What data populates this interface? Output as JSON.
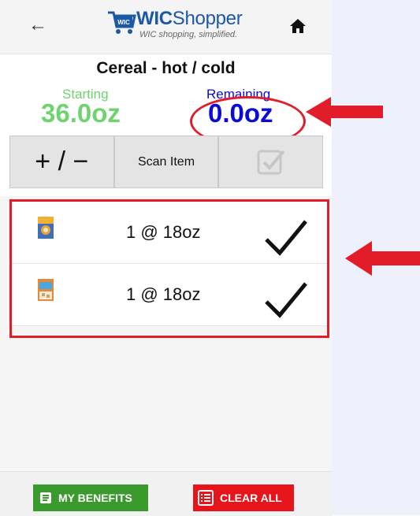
{
  "header": {
    "back_icon": "arrow-left-icon",
    "home_icon": "home-icon",
    "logo_title_bold": "WIC",
    "logo_title_rest": "Shopper",
    "logo_tagline": "WIC shopping, simplified.",
    "logo_badge": "WIC"
  },
  "category": {
    "title": "Cereal - hot / cold",
    "starting_label": "Starting",
    "starting_value": "36.0oz",
    "remaining_label": "Remaining",
    "remaining_value": "0.0oz"
  },
  "actions": {
    "plus_minus_label": "+ / −",
    "scan_label": "Scan Item",
    "confirm_icon": "checkbox-icon"
  },
  "items": [
    {
      "text": "1 @ 18oz",
      "image_icon": "cereal-box-icon",
      "status_icon": "checkmark-icon"
    },
    {
      "text": "1 @ 18oz",
      "image_icon": "cereal-box-icon",
      "status_icon": "checkmark-icon"
    }
  ],
  "footer": {
    "benefits_label": "MY BENEFITS",
    "clear_label": "CLEAR ALL"
  },
  "colors": {
    "starting": "#6fd36f",
    "remaining": "#0b0bd8",
    "annotation": "#e11d2a",
    "benefits_bg": "#3a9a2e",
    "clear_bg": "#e8141c",
    "brand": "#1b58a8"
  }
}
